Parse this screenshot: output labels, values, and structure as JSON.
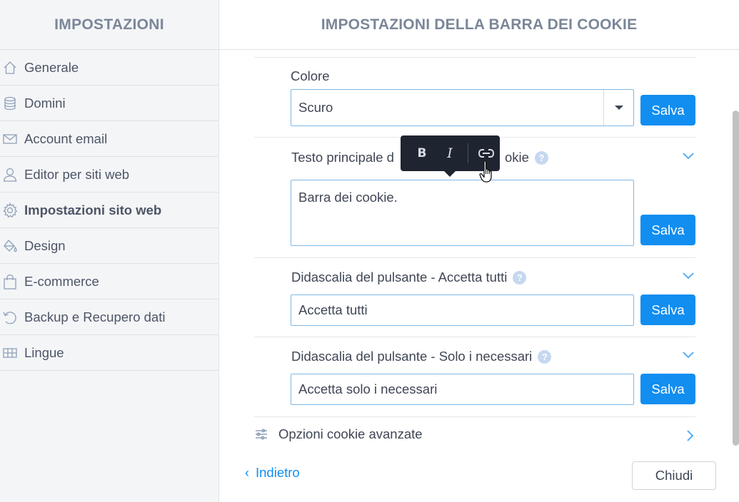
{
  "sidebar": {
    "title": "IMPOSTAZIONI",
    "items": [
      {
        "label": "Generale",
        "icon": "home-icon"
      },
      {
        "label": "Domini",
        "icon": "database-icon"
      },
      {
        "label": "Account email",
        "icon": "envelope-icon"
      },
      {
        "label": "Editor per siti web",
        "icon": "user-icon"
      },
      {
        "label": "Impostazioni sito web",
        "icon": "gear-icon",
        "active": true
      },
      {
        "label": "Design",
        "icon": "paint-bucket-icon"
      },
      {
        "label": "E-commerce",
        "icon": "shopping-bag-icon"
      },
      {
        "label": "Backup e Recupero dati",
        "icon": "restore-icon"
      },
      {
        "label": "Lingue",
        "icon": "language-grid-icon"
      }
    ]
  },
  "main": {
    "title": "IMPOSTAZIONI DELLA BARRA DEI COOKIE",
    "color": {
      "label": "Colore",
      "value": "Scuro",
      "save_label": "Salva"
    },
    "main_text": {
      "label": "Testo principale della barra dei cookie",
      "label_visible_start": "Testo principale d",
      "label_visible_end": "okie",
      "help": "?",
      "value": "Barra dei cookie.",
      "save_label": "Salva"
    },
    "accept_all": {
      "label": "Didascalia del pulsante - Accetta tutti",
      "help": "?",
      "value": "Accetta tutti",
      "save_label": "Salva"
    },
    "necessary_only": {
      "label": "Didascalia del pulsante - Solo i necessari",
      "help": "?",
      "value": "Accetta solo i necessari",
      "save_label": "Salva"
    },
    "advanced": {
      "label": "Opzioni cookie avanzate"
    },
    "toolbar": {
      "bold": "B",
      "italic": "I"
    },
    "footer": {
      "back_label": "Indietro",
      "close_label": "Chiudi"
    }
  },
  "colors": {
    "accent": "#118ef0",
    "sidebar_bg": "#f4f5f7",
    "toolbar_bg": "#1f2530",
    "help_badge": "#c5d8f0"
  }
}
